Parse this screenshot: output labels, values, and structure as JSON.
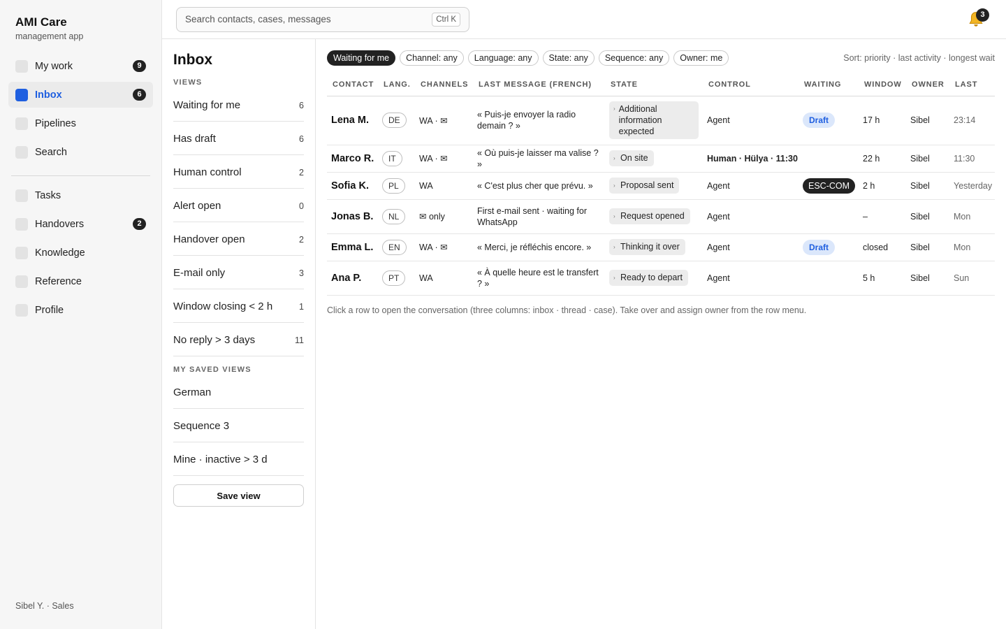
{
  "brand": {
    "title": "AMI Care",
    "subtitle": "management app"
  },
  "nav_primary": [
    {
      "label": "My work",
      "badge": "9",
      "active": false
    },
    {
      "label": "Inbox",
      "badge": "6",
      "active": true
    },
    {
      "label": "Pipelines",
      "badge": "",
      "active": false
    },
    {
      "label": "Search",
      "badge": "",
      "active": false
    }
  ],
  "nav_secondary": [
    {
      "label": "Tasks",
      "badge": ""
    },
    {
      "label": "Handovers",
      "badge": "2"
    },
    {
      "label": "Knowledge",
      "badge": ""
    },
    {
      "label": "Reference",
      "badge": ""
    },
    {
      "label": "Profile",
      "badge": ""
    }
  ],
  "user": "Sibel Y. · Sales",
  "search": {
    "placeholder": "Search contacts, cases, messages",
    "shortcut": "Ctrl K"
  },
  "notifications": {
    "count": "3",
    "icon": "bell-icon"
  },
  "views_panel": {
    "title": "Inbox",
    "views_heading": "VIEWS",
    "views": [
      {
        "label": "Waiting for me",
        "count": "6"
      },
      {
        "label": "Has draft",
        "count": "6"
      },
      {
        "label": "Human control",
        "count": "2"
      },
      {
        "label": "Alert open",
        "count": "0"
      },
      {
        "label": "Handover open",
        "count": "2"
      },
      {
        "label": "E-mail only",
        "count": "3"
      },
      {
        "label": "Window closing < 2 h",
        "count": "1"
      },
      {
        "label": "No reply > 3 days",
        "count": "11"
      }
    ],
    "saved_heading": "MY SAVED VIEWS",
    "saved": [
      {
        "label": "German"
      },
      {
        "label": "Sequence 3"
      },
      {
        "label": "Mine · inactive > 3 d"
      }
    ],
    "save_button": "Save view"
  },
  "filters": [
    {
      "label": "Waiting for me",
      "active": true
    },
    {
      "label": "Channel: any",
      "active": false
    },
    {
      "label": "Language: any",
      "active": false
    },
    {
      "label": "State: any",
      "active": false
    },
    {
      "label": "Sequence: any",
      "active": false
    },
    {
      "label": "Owner: me",
      "active": false
    }
  ],
  "sort": "Sort: priority · last activity · longest wait",
  "table": {
    "columns": [
      "CONTACT",
      "LANG.",
      "CHANNELS",
      "LAST MESSAGE (FRENCH)",
      "STATE",
      "CONTROL",
      "WAITING",
      "WINDOW",
      "OWNER",
      "LAST"
    ],
    "rows": [
      {
        "contact": "Lena M.",
        "lang": "DE",
        "channels": "WA · ✉",
        "message": "« Puis-je envoyer la radio demain ? »",
        "state": "Additional information expected",
        "control": "Agent",
        "control_bold": false,
        "waiting": "Draft",
        "waiting_type": "draft",
        "window": "17 h",
        "owner": "Sibel",
        "last": "23:14"
      },
      {
        "contact": "Marco R.",
        "lang": "IT",
        "channels": "WA · ✉",
        "message": "« Où puis-je laisser ma valise ? »",
        "state": "On site",
        "control": "Human · Hülya · 11:30",
        "control_bold": true,
        "waiting": "",
        "waiting_type": "",
        "window": "22 h",
        "owner": "Sibel",
        "last": "11:30"
      },
      {
        "contact": "Sofia K.",
        "lang": "PL",
        "channels": "WA",
        "message": "« C'est plus cher que prévu. »",
        "state": "Proposal sent",
        "control": "Agent",
        "control_bold": false,
        "waiting": "ESC-COM",
        "waiting_type": "esc",
        "window": "2 h",
        "owner": "Sibel",
        "last": "Yesterday"
      },
      {
        "contact": "Jonas B.",
        "lang": "NL",
        "channels": "✉ only",
        "message": "First e-mail sent · waiting for WhatsApp",
        "state": "Request opened",
        "control": "Agent",
        "control_bold": false,
        "waiting": "",
        "waiting_type": "",
        "window": "–",
        "owner": "Sibel",
        "last": "Mon"
      },
      {
        "contact": "Emma L.",
        "lang": "EN",
        "channels": "WA · ✉",
        "message": "« Merci, je réfléchis encore. »",
        "state": "Thinking it over",
        "control": "Agent",
        "control_bold": false,
        "waiting": "Draft",
        "waiting_type": "draft",
        "window": "closed",
        "owner": "Sibel",
        "last": "Mon"
      },
      {
        "contact": "Ana P.",
        "lang": "PT",
        "channels": "WA",
        "message": "« À quelle heure est le transfert ? »",
        "state": "Ready to depart",
        "control": "Agent",
        "control_bold": false,
        "waiting": "",
        "waiting_type": "",
        "window": "5 h",
        "owner": "Sibel",
        "last": "Sun"
      }
    ]
  },
  "hint": "Click a row to open the conversation (three columns: inbox · thread · case). Take over and assign owner from the row menu."
}
